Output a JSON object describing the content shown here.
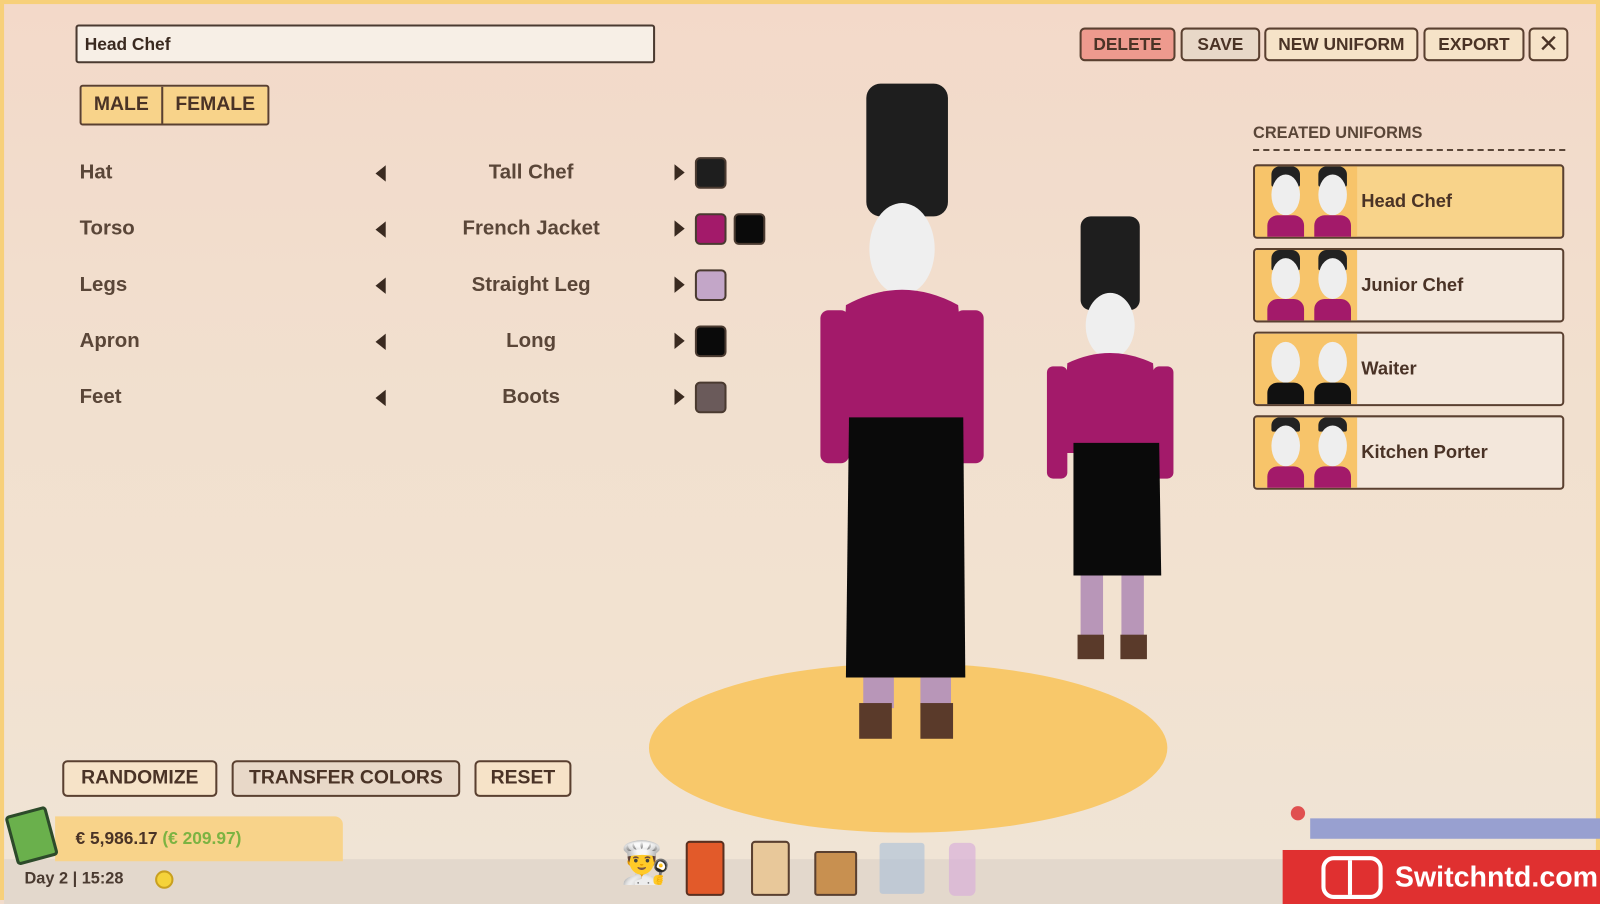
{
  "uniform_name": "Head Chef",
  "toolbar": {
    "delete": "DELETE",
    "save": "SAVE",
    "new_uniform": "NEW UNIFORM",
    "export": "EXPORT",
    "close_icon": "close-icon"
  },
  "gender": {
    "male": "MALE",
    "female": "FEMALE",
    "selected": "FEMALE"
  },
  "parts": [
    {
      "label": "Hat",
      "value": "Tall Chef",
      "colors": [
        "#1e1e1e"
      ]
    },
    {
      "label": "Torso",
      "value": "French Jacket",
      "colors": [
        "#a31a6a",
        "#0a0a0a"
      ]
    },
    {
      "label": "Legs",
      "value": "Straight Leg",
      "colors": [
        "#c3a6c8"
      ]
    },
    {
      "label": "Apron",
      "value": "Long",
      "colors": [
        "#0a0a0a"
      ]
    },
    {
      "label": "Feet",
      "value": "Boots",
      "colors": [
        "#6a5a5a"
      ]
    }
  ],
  "created_uniforms": {
    "title": "CREATED UNIFORMS",
    "items": [
      {
        "label": "Head Chef",
        "selected": true
      },
      {
        "label": "Junior Chef"
      },
      {
        "label": "Waiter"
      },
      {
        "label": "Kitchen Porter"
      }
    ]
  },
  "actions": {
    "randomize": "RANDOMIZE",
    "transfer": "TRANSFER COLORS",
    "reset": "RESET"
  },
  "status": {
    "money": "€ 5,986.17",
    "income": "(€ 209.97)",
    "day_time": "Day 2 | 15:28"
  },
  "watermark": "Switchntd.com"
}
